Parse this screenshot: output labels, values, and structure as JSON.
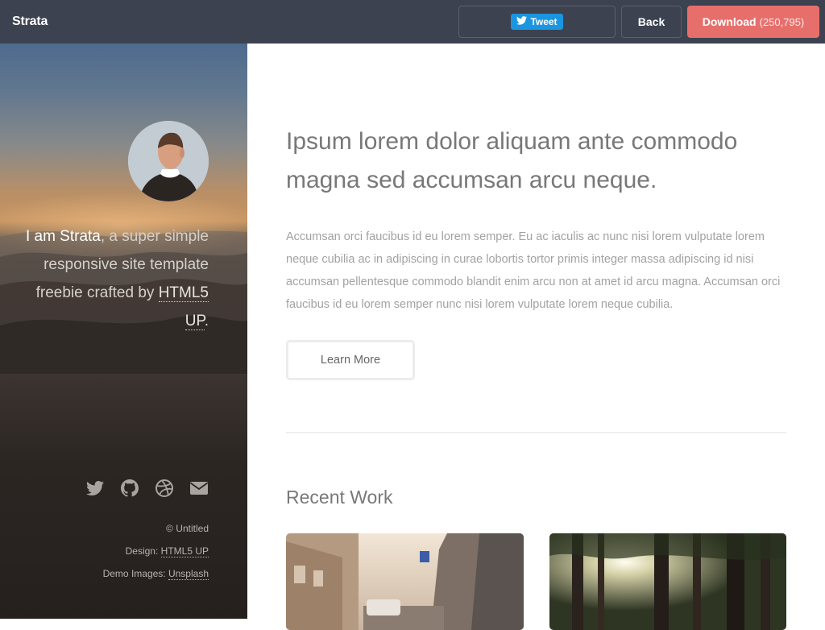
{
  "header": {
    "brand": "Strata",
    "tweet_label": "Tweet",
    "back_label": "Back",
    "download_label": "Download",
    "download_count": "(250,795)"
  },
  "sidebar": {
    "intro_name": "I am Strata",
    "intro_text": ", a super simple responsive site template freebie crafted by ",
    "intro_link": "HTML5 UP",
    "intro_end": ".",
    "social_icons": [
      "twitter-icon",
      "github-icon",
      "dribbble-icon",
      "envelope-icon"
    ],
    "credits": {
      "copyright": "© Untitled",
      "design_label": "Design: ",
      "design_link": "HTML5 UP",
      "images_label": "Demo Images: ",
      "images_link": "Unsplash"
    }
  },
  "main": {
    "headline": "Ipsum lorem dolor aliquam ante commodo magna sed accumsan arcu neque.",
    "lead": "Accumsan orci faucibus id eu lorem semper. Eu ac iaculis ac nunc nisi lorem vulputate lorem neque cubilia ac in adipiscing in curae lobortis tortor primis integer massa adipiscing id nisi accumsan pellentesque commodo blandit enim arcu non at amet id arcu magna. Accumsan orci faucibus id eu lorem semper nunc nisi lorem vulputate lorem neque cubilia.",
    "learn_more": "Learn More",
    "recent_work_title": "Recent Work"
  },
  "colors": {
    "topbar": "#3c4250",
    "download": "#e76f6b",
    "tweet": "#1b95e0",
    "headline": "#787878",
    "body_text": "#a2a2a2"
  }
}
